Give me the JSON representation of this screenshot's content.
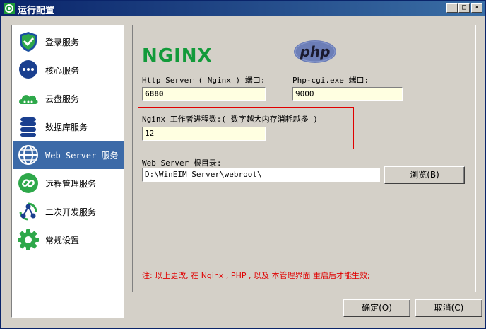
{
  "window": {
    "title": "运行配置"
  },
  "titlebar": {
    "minimize": "_",
    "restore": "□",
    "close": "×"
  },
  "sidebar": {
    "items": [
      {
        "label": "登录服务",
        "icon": "shield-check-icon"
      },
      {
        "label": "核心服务",
        "icon": "chat-bubble-icon"
      },
      {
        "label": "云盘服务",
        "icon": "cloud-icon"
      },
      {
        "label": "数据库服务",
        "icon": "database-icon"
      },
      {
        "label": "Web Server 服务",
        "icon": "globe-icon",
        "selected": true
      },
      {
        "label": "远程管理服务",
        "icon": "link-icon"
      },
      {
        "label": "二次开发服务",
        "icon": "share-nodes-icon"
      },
      {
        "label": "常规设置",
        "icon": "gear-icon"
      }
    ]
  },
  "logos": {
    "nginx": "NGINX",
    "php": "php"
  },
  "form": {
    "http_port_label": "Http Server ( Nginx ) 端口:",
    "http_port_value": "6880",
    "php_port_label": "Php-cgi.exe 端口:",
    "php_port_value": "9000",
    "worker_label": "Nginx 工作者进程数:( 数字越大内存消耗越多 )",
    "worker_value": "12",
    "root_label": "Web Server 根目录:",
    "root_value": "D:\\WinEIM Server\\webroot\\",
    "browse_label": "浏览(B)"
  },
  "note": "注: 以上更改, 在 Nginx , PHP , 以及 本管理界面 重启后才能生效;",
  "footer": {
    "ok_label": "确定(O)",
    "cancel_label": "取消(C)"
  },
  "colors": {
    "selected": "#3c6aa8",
    "nginx_green": "#129a3a",
    "php_purple": "#6c7eb7",
    "note_red": "#e00000",
    "field_yellow": "#ffffe1"
  }
}
